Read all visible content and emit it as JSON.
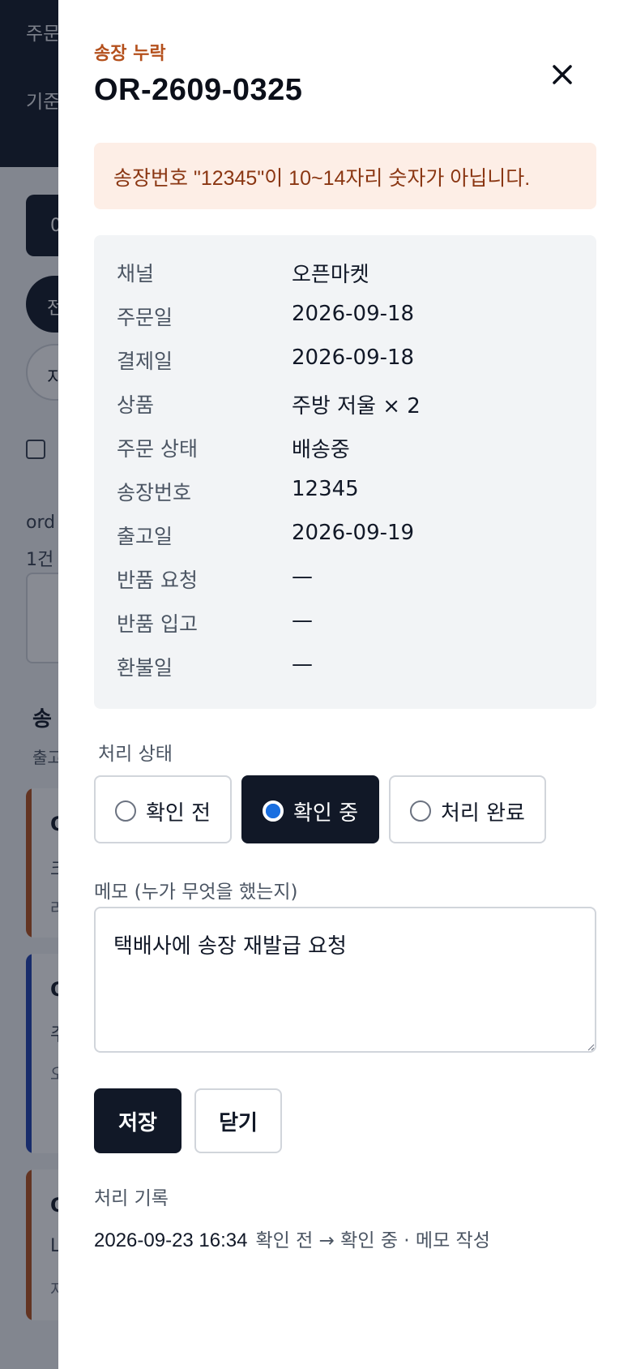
{
  "background": {
    "header_lines": [
      "주문",
      "기준"
    ],
    "button_partial": "0",
    "pill_dark_partial": "전",
    "pill_light_partial": "지",
    "meta_line1": "ord",
    "meta_line2": "1건",
    "section_title_partial": "송",
    "section_sub_partial": "출고",
    "cards": [
      {
        "t1": "O",
        "t2": "크",
        "t3": "라",
        "accent": "#b4501c"
      },
      {
        "t1": "O",
        "t2": "주",
        "t3": "오",
        "accent": "#1e40af"
      },
      {
        "t1": "O",
        "t2": "L",
        "t3": "저",
        "accent": "#b4501c"
      }
    ]
  },
  "drawer": {
    "eyebrow": "송장 누락",
    "title": "OR-2609-0325",
    "close_icon": "close-icon",
    "alert": "송장번호 \"12345\"이 10~14자리 숫자가 아닙니다.",
    "info": [
      {
        "label": "채널",
        "value": "오픈마켓"
      },
      {
        "label": "주문일",
        "value": "2026-09-18"
      },
      {
        "label": "결제일",
        "value": "2026-09-18"
      },
      {
        "label": "상품",
        "value": "주방 저울 × 2"
      },
      {
        "label": "주문 상태",
        "value": "배송중"
      },
      {
        "label": "송장번호",
        "value": "12345"
      },
      {
        "label": "출고일",
        "value": "2026-09-19"
      },
      {
        "label": "반품 요청",
        "value": "—"
      },
      {
        "label": "반품 입고",
        "value": "—"
      },
      {
        "label": "환불일",
        "value": "—"
      }
    ],
    "status_label": "처리 상태",
    "status_options": [
      "확인 전",
      "확인 중",
      "처리 완료"
    ],
    "status_selected": "확인 중",
    "memo_label": "메모 (누가 무엇을 했는지)",
    "memo_value": "택배사에 송장 재발급 요청",
    "save_label": "저장",
    "close_label": "닫기",
    "history_label": "처리 기록",
    "history": [
      {
        "time": "2026-09-23 16:34",
        "desc": "확인 전 → 확인 중 · 메모 작성"
      }
    ]
  },
  "colors": {
    "accent_warning": "#b4501c",
    "alert_bg": "#fdeee6",
    "primary_dark": "#111827",
    "radio_selected": "#1a6fe0"
  }
}
